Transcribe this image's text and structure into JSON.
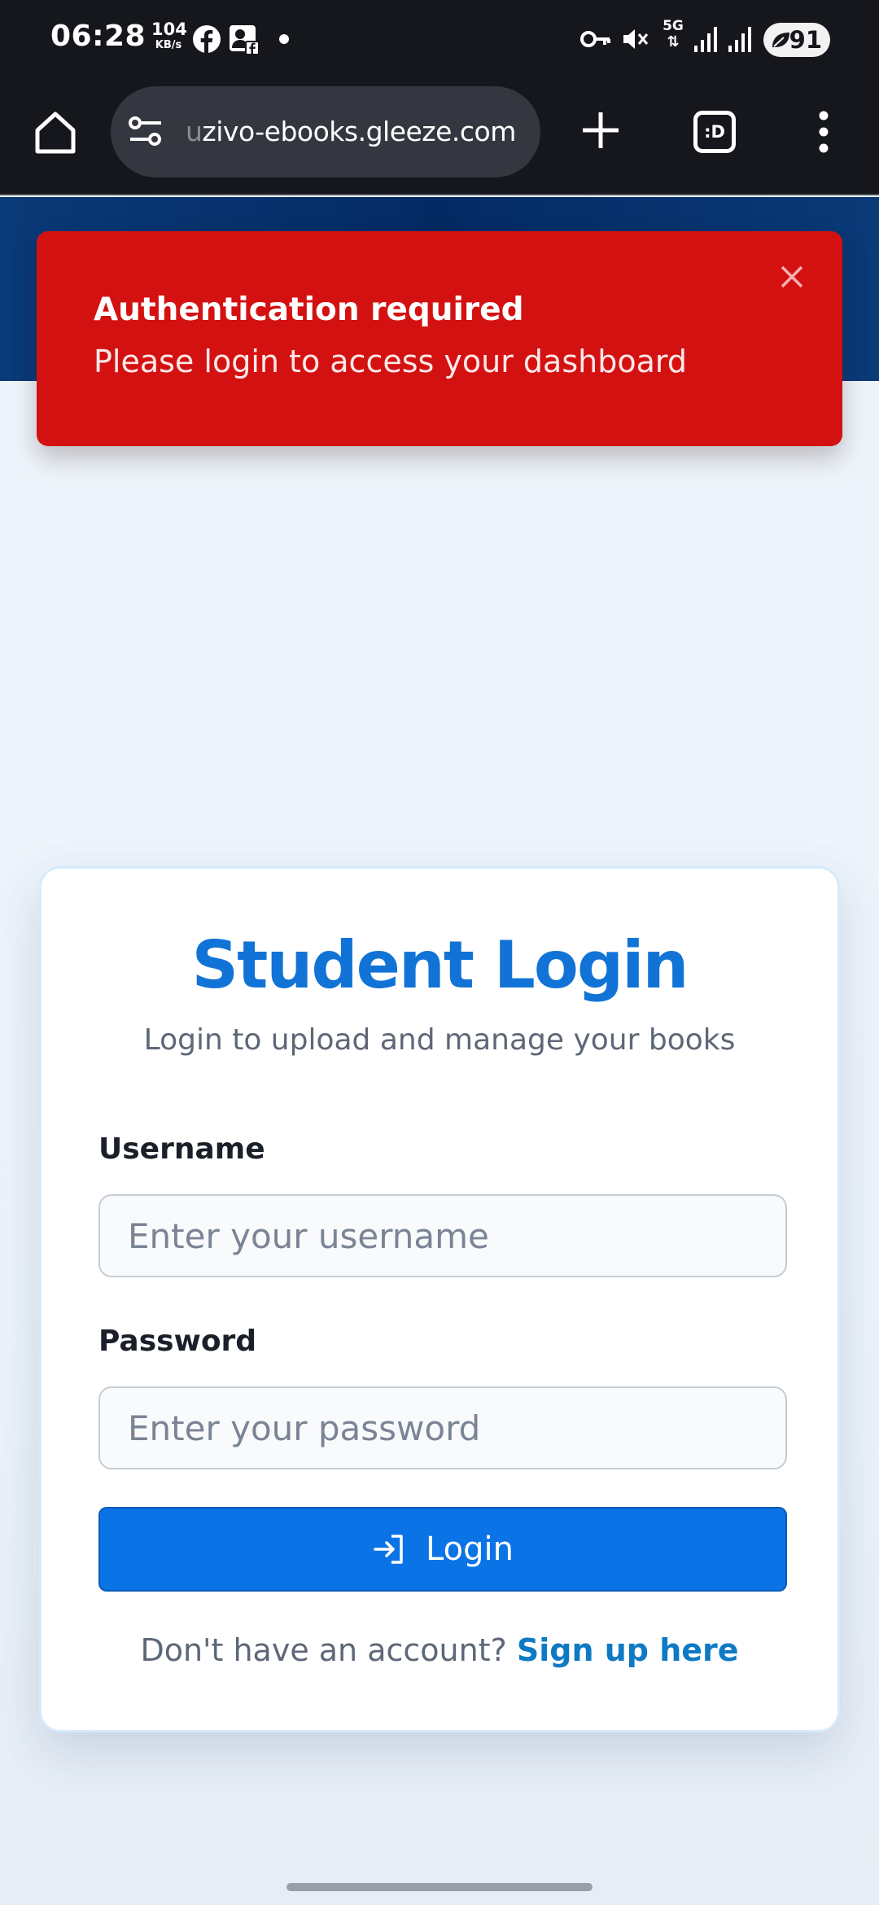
{
  "status_bar": {
    "time": "06:28",
    "net_speed_value": "104",
    "net_speed_unit": "KB/s",
    "network_type": "5G",
    "battery_level": "91"
  },
  "browser": {
    "url_faded": "u",
    "url": "zivo-ebooks.gleeze.com",
    "tabs_label": ":D"
  },
  "toast": {
    "title": "Authentication required",
    "message": "Please login to access your dashboard",
    "background_color": "#d41111"
  },
  "login": {
    "title": "Student Login",
    "subtitle": "Login to upload and manage your books",
    "username_label": "Username",
    "username_placeholder": "Enter your username",
    "password_label": "Password",
    "password_placeholder": "Enter your password",
    "button_label": "Login",
    "signup_prompt": "Don't have an account? ",
    "signup_link": "Sign up here",
    "accent_color": "#0a73e6"
  },
  "icons": {
    "status": [
      "facebook-icon",
      "contact-card-icon",
      "vpn-key-icon",
      "vibrate-mute-icon",
      "signal-icon"
    ],
    "browser": [
      "home-icon",
      "site-settings-icon",
      "plus-icon",
      "tab-switcher-icon",
      "more-vert-icon"
    ],
    "login_button": "login-arrow-icon",
    "toast": "close-icon"
  }
}
